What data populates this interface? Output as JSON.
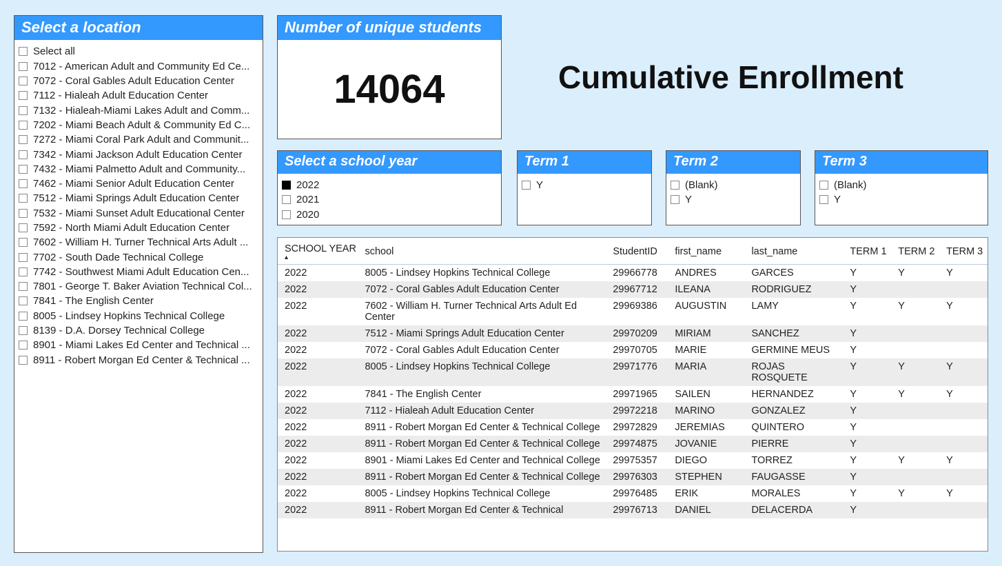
{
  "page_title": "Cumulative Enrollment",
  "location_slicer": {
    "header": "Select a location",
    "select_all_label": "Select all",
    "items": [
      "7012 - American Adult and Community Ed Ce...",
      "7072 - Coral Gables Adult Education Center",
      "7112 - Hialeah Adult Education Center",
      "7132 - Hialeah-Miami Lakes Adult and Comm...",
      "7202 - Miami Beach Adult & Community Ed C...",
      "7272 - Miami Coral Park Adult and Communit...",
      "7342 - Miami Jackson Adult Education Center",
      "7432 - Miami Palmetto Adult and Community...",
      "7462 - Miami Senior Adult Education Center",
      "7512 - Miami Springs Adult Education Center",
      "7532 - Miami Sunset Adult Educational Center",
      "7592 - North Miami Adult Education Center",
      "7602 - William H. Turner Technical Arts Adult ...",
      "7702 - South Dade Technical College",
      "7742 - Southwest Miami Adult Education Cen...",
      "7801 - George T. Baker Aviation Technical Col...",
      "7841 - The English Center",
      "8005 - Lindsey Hopkins Technical College",
      "8139 - D.A. Dorsey Technical College",
      "8901 - Miami Lakes Ed Center and Technical ...",
      "8911 - Robert Morgan Ed Center & Technical ..."
    ]
  },
  "kpi": {
    "header": "Number of unique students",
    "value": "14064"
  },
  "year_slicer": {
    "header": "Select a school year",
    "options": [
      {
        "label": "2022",
        "checked": true
      },
      {
        "label": "2021",
        "checked": false
      },
      {
        "label": "2020",
        "checked": false
      }
    ]
  },
  "term1_slicer": {
    "header": "Term 1",
    "options": [
      {
        "label": "Y",
        "checked": false
      }
    ]
  },
  "term2_slicer": {
    "header": "Term 2",
    "options": [
      {
        "label": "(Blank)",
        "checked": false
      },
      {
        "label": "Y",
        "checked": false
      }
    ]
  },
  "term3_slicer": {
    "header": "Term 3",
    "options": [
      {
        "label": "(Blank)",
        "checked": false
      },
      {
        "label": "Y",
        "checked": false
      }
    ]
  },
  "table": {
    "columns": [
      "SCHOOL YEAR",
      "school",
      "StudentID",
      "first_name",
      "last_name",
      "TERM 1",
      "TERM 2",
      "TERM 3"
    ],
    "rows": [
      {
        "year": "2022",
        "school": "8005 - Lindsey Hopkins Technical College",
        "id": "29966778",
        "fn": "ANDRES",
        "ln": "GARCES",
        "t1": "Y",
        "t2": "Y",
        "t3": "Y"
      },
      {
        "year": "2022",
        "school": "7072 - Coral Gables Adult Education Center",
        "id": "29967712",
        "fn": "ILEANA",
        "ln": "RODRIGUEZ",
        "t1": "Y",
        "t2": "",
        "t3": ""
      },
      {
        "year": "2022",
        "school": "7602 - William H. Turner Technical Arts Adult Ed Center",
        "id": "29969386",
        "fn": "AUGUSTIN",
        "ln": "LAMY",
        "t1": "Y",
        "t2": "Y",
        "t3": "Y"
      },
      {
        "year": "2022",
        "school": "7512 - Miami Springs Adult Education Center",
        "id": "29970209",
        "fn": "MIRIAM",
        "ln": "SANCHEZ",
        "t1": "Y",
        "t2": "",
        "t3": ""
      },
      {
        "year": "2022",
        "school": "7072 - Coral Gables Adult Education Center",
        "id": "29970705",
        "fn": "MARIE",
        "ln": "GERMINE MEUS",
        "t1": "Y",
        "t2": "",
        "t3": ""
      },
      {
        "year": "2022",
        "school": "8005 - Lindsey Hopkins Technical College",
        "id": "29971776",
        "fn": "MARIA",
        "ln": "ROJAS ROSQUETE",
        "t1": "Y",
        "t2": "Y",
        "t3": "Y"
      },
      {
        "year": "2022",
        "school": "7841 - The English Center",
        "id": "29971965",
        "fn": "SAILEN",
        "ln": "HERNANDEZ",
        "t1": "Y",
        "t2": "Y",
        "t3": "Y"
      },
      {
        "year": "2022",
        "school": "7112 - Hialeah Adult Education Center",
        "id": "29972218",
        "fn": "MARINO",
        "ln": "GONZALEZ",
        "t1": "Y",
        "t2": "",
        "t3": ""
      },
      {
        "year": "2022",
        "school": "8911 - Robert Morgan Ed Center & Technical College",
        "id": "29972829",
        "fn": "JEREMIAS",
        "ln": "QUINTERO",
        "t1": "Y",
        "t2": "",
        "t3": ""
      },
      {
        "year": "2022",
        "school": "8911 - Robert Morgan Ed Center & Technical College",
        "id": "29974875",
        "fn": "JOVANIE",
        "ln": "PIERRE",
        "t1": "Y",
        "t2": "",
        "t3": ""
      },
      {
        "year": "2022",
        "school": "8901 - Miami Lakes Ed Center and Technical College",
        "id": "29975357",
        "fn": "DIEGO",
        "ln": "TORREZ",
        "t1": "Y",
        "t2": "Y",
        "t3": "Y"
      },
      {
        "year": "2022",
        "school": "8911 - Robert Morgan Ed Center & Technical College",
        "id": "29976303",
        "fn": "STEPHEN",
        "ln": "FAUGASSE",
        "t1": "Y",
        "t2": "",
        "t3": ""
      },
      {
        "year": "2022",
        "school": "8005 - Lindsey Hopkins Technical College",
        "id": "29976485",
        "fn": "ERIK",
        "ln": "MORALES",
        "t1": "Y",
        "t2": "Y",
        "t3": "Y"
      },
      {
        "year": "2022",
        "school": "8911 - Robert Morgan Ed Center & Technical",
        "id": "29976713",
        "fn": "DANIEL",
        "ln": "DELACERDA",
        "t1": "Y",
        "t2": "",
        "t3": ""
      }
    ]
  }
}
